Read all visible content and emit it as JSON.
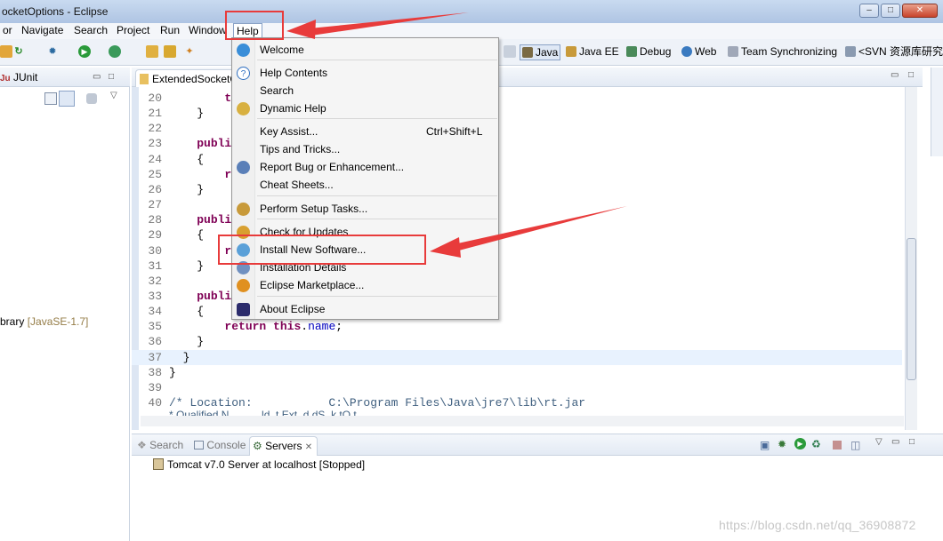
{
  "window": {
    "title": "ocketOptions - Eclipse",
    "controls": [
      "minimize-icon",
      "maximize-icon",
      "close-icon"
    ]
  },
  "menubar": {
    "items": [
      "or",
      "Navigate",
      "Search",
      "Project",
      "Run",
      "Window",
      "Help"
    ],
    "active": "Help"
  },
  "toolbar": {
    "perspectives": [
      {
        "label": "Java",
        "selected": true
      },
      {
        "label": "Java EE"
      },
      {
        "label": "Debug"
      },
      {
        "label": "Web"
      },
      {
        "label": "Team Synchronizing"
      },
      {
        "label": "<SVN 资源库研究>"
      }
    ]
  },
  "left_panel": {
    "tab": "JUnit",
    "fragment": "brary",
    "fragment_suffix": "[JavaSE-1.7]"
  },
  "editor": {
    "tab": "ExtendedSocketO",
    "lines": [
      {
        "n": "20",
        "parts": [
          [
            "",
            "        "
          ],
          [
            "kw",
            "thi"
          ]
        ]
      },
      {
        "n": "21",
        "parts": [
          [
            "",
            "    }"
          ]
        ]
      },
      {
        "n": "22",
        "parts": [
          [
            "",
            ""
          ]
        ]
      },
      {
        "n": "23",
        "parts": [
          [
            "",
            "    "
          ],
          [
            "kw",
            "publi"
          ]
        ]
      },
      {
        "n": "24",
        "parts": [
          [
            "",
            "    {"
          ]
        ]
      },
      {
        "n": "25",
        "parts": [
          [
            "",
            "        "
          ],
          [
            "kw",
            "ret"
          ]
        ]
      },
      {
        "n": "26",
        "parts": [
          [
            "",
            "    }"
          ]
        ]
      },
      {
        "n": "27",
        "parts": [
          [
            "",
            ""
          ]
        ]
      },
      {
        "n": "28",
        "parts": [
          [
            "",
            "    "
          ],
          [
            "kw",
            "publi"
          ]
        ]
      },
      {
        "n": "29",
        "parts": [
          [
            "",
            "    {"
          ]
        ]
      },
      {
        "n": "30",
        "parts": [
          [
            "",
            "        "
          ],
          [
            "kw",
            "ret"
          ]
        ]
      },
      {
        "n": "31",
        "parts": [
          [
            "",
            "    }"
          ]
        ]
      },
      {
        "n": "32",
        "parts": [
          [
            "",
            ""
          ]
        ]
      },
      {
        "n": "33",
        "parts": [
          [
            "",
            "    "
          ],
          [
            "kw",
            "publi"
          ]
        ]
      },
      {
        "n": "34",
        "parts": [
          [
            "",
            "    {"
          ]
        ]
      },
      {
        "n": "35",
        "parts": [
          [
            "",
            "        "
          ],
          [
            "kw",
            "return"
          ],
          [
            "",
            " "
          ],
          [
            "kw",
            "this"
          ],
          [
            "",
            "."
          ],
          [
            "fld",
            "name"
          ],
          [
            "",
            ";"
          ]
        ]
      },
      {
        "n": "36",
        "parts": [
          [
            "",
            "    }"
          ]
        ]
      },
      {
        "n": "37",
        "parts": [
          [
            "",
            "  }"
          ]
        ],
        "highlight": true
      },
      {
        "n": "38",
        "parts": [
          [
            "",
            "}"
          ]
        ]
      },
      {
        "n": "39",
        "parts": [
          [
            "",
            ""
          ]
        ]
      },
      {
        "n": "40",
        "parts": [
          [
            "cmt",
            "/* Location:           C:\\Program Files\\Java\\jre7\\lib\\rt.jar"
          ]
        ]
      }
    ],
    "partial_line": "* Qualified N        ...ld..t.Ext..d.dS..k.tO.t"
  },
  "help_menu": {
    "groups": [
      [
        {
          "label": "Welcome",
          "icon": "globe-icon",
          "color": "#3a8ed8"
        }
      ],
      [
        {
          "label": "Help Contents",
          "icon": "question-icon",
          "color": "#2f6fc0"
        },
        {
          "label": "Search",
          "icon": "",
          "color": ""
        },
        {
          "label": "Dynamic Help",
          "icon": "dynamic-help-icon",
          "color": "#d8b040"
        }
      ],
      [
        {
          "label": "Key Assist...",
          "accel": "Ctrl+Shift+L",
          "icon": "",
          "color": ""
        },
        {
          "label": "Tips and Tricks...",
          "icon": "",
          "color": ""
        },
        {
          "label": "Report Bug or Enhancement...",
          "icon": "bug-icon",
          "color": "#5a7fb8"
        },
        {
          "label": "Cheat Sheets...",
          "icon": "",
          "color": ""
        }
      ],
      [
        {
          "label": "Perform Setup Tasks...",
          "icon": "setup-icon",
          "color": "#c89a3a"
        }
      ],
      [
        {
          "label": "Check for Updates",
          "icon": "update-icon",
          "color": "#d8a030"
        },
        {
          "label": "Install New Software...",
          "icon": "install-icon",
          "color": "#5aa0d8"
        },
        {
          "label": "Installation Details",
          "icon": "details-icon",
          "color": "#7090c0"
        },
        {
          "label": "Eclipse Marketplace...",
          "icon": "marketplace-icon",
          "color": "#e09020"
        }
      ],
      [
        {
          "label": "About Eclipse",
          "icon": "eclipse-icon",
          "color": "#2c2c6c"
        }
      ]
    ]
  },
  "bottom_panel": {
    "tabs": [
      {
        "label": "Search",
        "selected": false
      },
      {
        "label": "Console",
        "selected": false
      },
      {
        "label": "Servers",
        "selected": true
      }
    ],
    "server_row": "Tomcat v7.0 Server at localhost  [Stopped]"
  },
  "watermark": "https://blog.csdn.net/qq_36908872",
  "annotation_color": "#e83b3b"
}
